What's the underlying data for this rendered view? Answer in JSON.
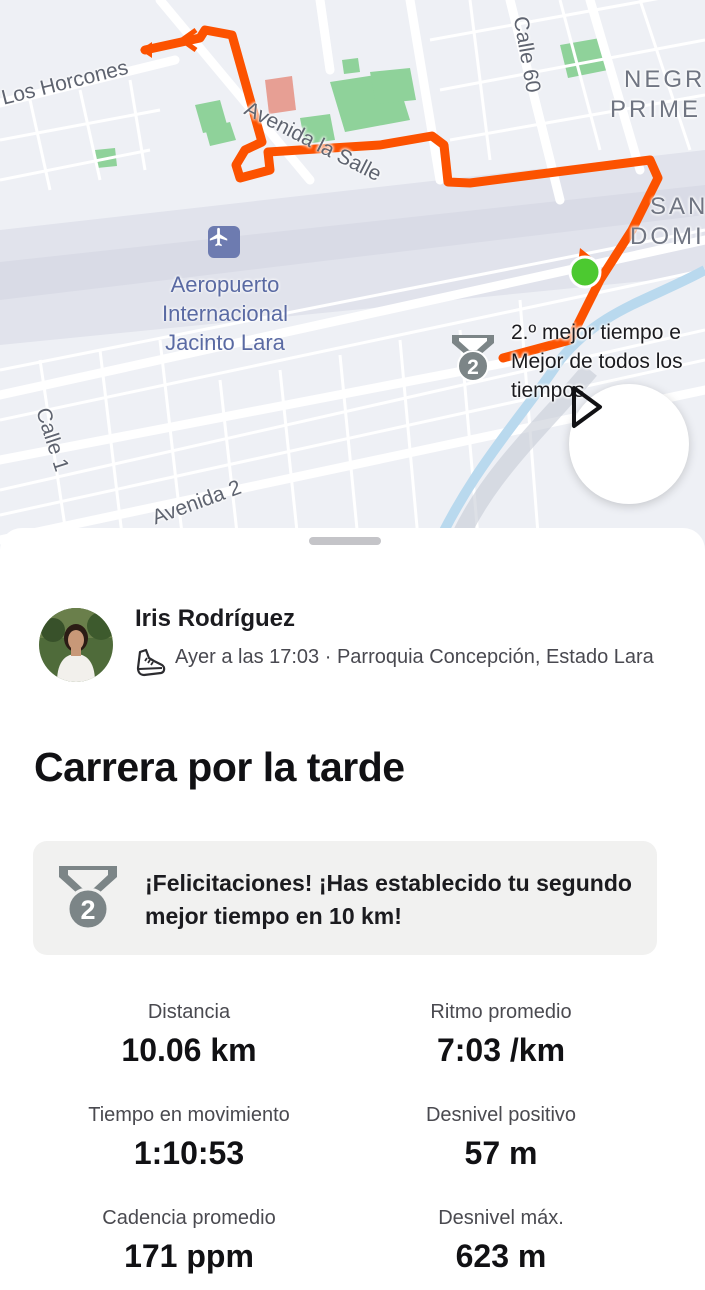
{
  "map": {
    "streets": {
      "los_horcones": "Los Horcones",
      "avenida_la_salle": "Avenida la Salle",
      "calle_60": "Calle 60",
      "calle_1": "Calle 1",
      "avenida_2": "Avenida 2"
    },
    "areas": {
      "negr_line1": "NEGR",
      "negr_line2": "PRIME",
      "san_line1": "SAN",
      "san_line2": "DOMI"
    },
    "airport": {
      "name_line1": "Aeropuerto",
      "name_line2": "Internacional",
      "name_line3": "Jacinto Lara",
      "icon": "airplane-icon"
    },
    "segment_note": {
      "line1": "2.º mejor tiempo e",
      "line2": "Mejor de todos los",
      "line3": "tiempos"
    },
    "medal_rank": "2",
    "route_color": "#fc5200",
    "start_marker_color": "#4cc930",
    "play_icon": "play-icon"
  },
  "athlete": {
    "name": "Iris Rodríguez",
    "meta": "Ayer a las 17:03 · Parroquia Concepción, Estado Lara",
    "sport_icon": "running-shoe-icon"
  },
  "activity": {
    "title": "Carrera por la tarde"
  },
  "achievement": {
    "rank": "2",
    "text": "¡Felicitaciones! ¡Has establecido tu segundo mejor tiempo en 10 km!",
    "medal_color": "#7c8587"
  },
  "stats": [
    {
      "label": "Distancia",
      "value": "10.06 km"
    },
    {
      "label": "Ritmo promedio",
      "value": "7:03 /km"
    },
    {
      "label": "Tiempo en movimiento",
      "value": "1:10:53"
    },
    {
      "label": "Desnivel positivo",
      "value": "57 m"
    },
    {
      "label": "Cadencia promedio",
      "value": "171 ppm"
    },
    {
      "label": "Desnivel máx.",
      "value": "623 m"
    }
  ]
}
